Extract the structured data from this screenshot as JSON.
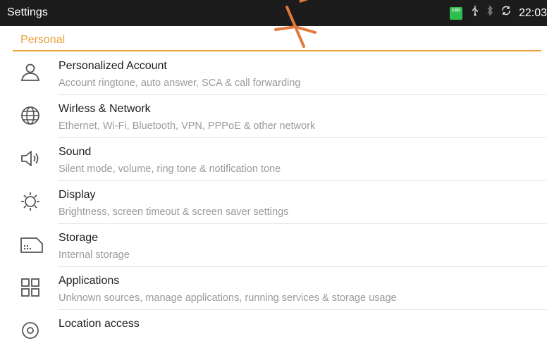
{
  "statusbar": {
    "title": "Settings",
    "ftp_badge": "FTP",
    "time": "22:03",
    "icons": [
      "ftp-icon",
      "usb-icon",
      "bluetooth-icon",
      "sync-icon"
    ]
  },
  "section": {
    "header": "Personal",
    "accent_color": "#e8a23a"
  },
  "items": [
    {
      "icon": "person-icon",
      "title": "Personalized Account",
      "subtitle": "Account ringtone, auto answer, SCA & call forwarding"
    },
    {
      "icon": "globe-icon",
      "title": "Wirless & Network",
      "subtitle": "Ethernet, Wi-Fi, Bluetooth, VPN, PPPoE & other network"
    },
    {
      "icon": "speaker-icon",
      "title": "Sound",
      "subtitle": "Silent mode, volume, ring tone & notification tone"
    },
    {
      "icon": "brightness-icon",
      "title": "Display",
      "subtitle": "Brightness, screen timeout & screen saver settings"
    },
    {
      "icon": "sd-card-icon",
      "title": "Storage",
      "subtitle": "Internal storage"
    },
    {
      "icon": "apps-grid-icon",
      "title": "Applications",
      "subtitle": "Unknown sources, manage applications, running services & storage usage"
    },
    {
      "icon": "location-icon",
      "title": "Location access",
      "subtitle": ""
    }
  ]
}
